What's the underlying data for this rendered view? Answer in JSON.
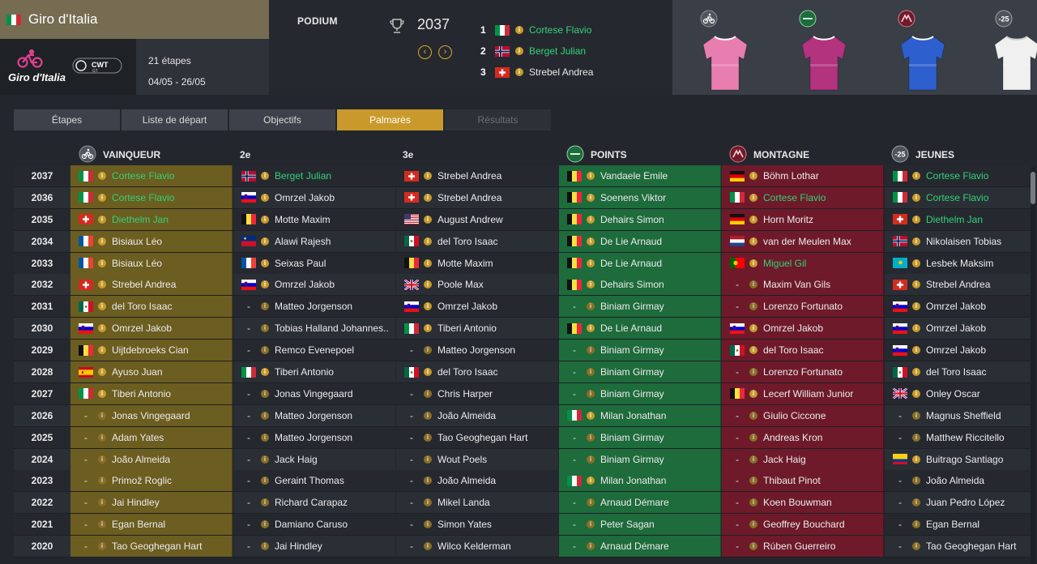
{
  "race": {
    "title": "Giro d'Italia",
    "flag": "it",
    "logo_text": "Giro d'Italia",
    "badge_text": "CWT",
    "badge_sub": "GT",
    "stages": "21 étapes",
    "dates": "04/05 - 26/05"
  },
  "podium": {
    "label": "PODIUM",
    "year": "2037",
    "prev_icon": "chevron-left-icon",
    "next_icon": "chevron-right-icon",
    "entries": [
      {
        "pos": "1",
        "flag": "it",
        "name": "Cortese Flavio",
        "highlight": true
      },
      {
        "pos": "2",
        "flag": "no",
        "name": "Berget Julian",
        "highlight": true
      },
      {
        "pos": "3",
        "flag": "ch",
        "name": "Strebel Andrea",
        "highlight": false
      }
    ]
  },
  "jerseys": [
    {
      "name": "leader-jersey",
      "icon": "cyclist-icon",
      "color": "#e87eb0"
    },
    {
      "name": "points-jersey",
      "icon": "points-icon",
      "color": "#b3337e"
    },
    {
      "name": "mountain-jersey",
      "icon": "mountain-icon",
      "color": "#2d5fcf"
    },
    {
      "name": "youth-jersey",
      "icon": "youth-icon",
      "color": "#f0f0f0"
    }
  ],
  "tabs": [
    {
      "label": "Étapes",
      "state": "normal"
    },
    {
      "label": "Liste de départ",
      "state": "normal"
    },
    {
      "label": "Objectifs",
      "state": "normal"
    },
    {
      "label": "Palmarès",
      "state": "active"
    },
    {
      "label": "Résultats",
      "state": "disabled"
    }
  ],
  "columns": {
    "winner": "VAINQUEUR",
    "second": "2e",
    "third": "3e",
    "points": "POINTS",
    "mountain": "MONTAGNE",
    "youth": "JEUNES",
    "youth_badge": "-25"
  },
  "colors": {
    "winner_bg": "#6c5d20",
    "points_bg": "#1e6b3c",
    "mountain_bg": "#6e1a2a",
    "active_tab": "#c99a2b",
    "highlight_name": "#33d17a"
  },
  "rows": [
    {
      "year": "2037",
      "win": {
        "flag": "it",
        "name": "Cortese Flavio",
        "hl": true
      },
      "second": {
        "flag": "no",
        "name": "Berget Julian",
        "hl": true
      },
      "third": {
        "flag": "ch",
        "name": "Strebel Andrea"
      },
      "points": {
        "flag": "be",
        "name": "Vandaele Emile"
      },
      "mountain": {
        "flag": "de",
        "name": "Böhm Lothar"
      },
      "youth": {
        "flag": "it",
        "name": "Cortese Flavio",
        "hl": true
      }
    },
    {
      "year": "2036",
      "win": {
        "flag": "it",
        "name": "Cortese Flavio",
        "hl": true
      },
      "second": {
        "flag": "si",
        "name": "Omrzel Jakob"
      },
      "third": {
        "flag": "ch",
        "name": "Strebel Andrea"
      },
      "points": {
        "flag": "be",
        "name": "Soenens Viktor"
      },
      "mountain": {
        "flag": "it",
        "name": "Cortese Flavio",
        "hl": true
      },
      "youth": {
        "flag": "it",
        "name": "Cortese Flavio",
        "hl": true
      }
    },
    {
      "year": "2035",
      "win": {
        "flag": "ch",
        "name": "Diethelm Jan",
        "hl": true
      },
      "second": {
        "flag": "be",
        "name": "Motte Maxim"
      },
      "third": {
        "flag": "us",
        "name": "August Andrew"
      },
      "points": {
        "flag": "be",
        "name": "Dehairs Simon"
      },
      "mountain": {
        "flag": "de",
        "name": "Horn Moritz"
      },
      "youth": {
        "flag": "ch",
        "name": "Diethelm Jan",
        "hl": true
      }
    },
    {
      "year": "2034",
      "win": {
        "flag": "fr",
        "name": "Bisiaux Léo"
      },
      "second": {
        "flag": "li",
        "name": "Alawi Rajesh"
      },
      "third": {
        "flag": "mx",
        "name": "del Toro Isaac"
      },
      "points": {
        "flag": "be",
        "name": "De Lie Arnaud"
      },
      "mountain": {
        "flag": "nl",
        "name": "van der Meulen Max"
      },
      "youth": {
        "flag": "no",
        "name": "Nikolaisen Tobias"
      }
    },
    {
      "year": "2033",
      "win": {
        "flag": "fr",
        "name": "Bisiaux Léo"
      },
      "second": {
        "flag": "fr",
        "name": "Seixas Paul"
      },
      "third": {
        "flag": "be",
        "name": "Motte Maxim"
      },
      "points": {
        "flag": "be",
        "name": "De Lie Arnaud"
      },
      "mountain": {
        "flag": "pt",
        "name": "Miguel Gil",
        "hl": true
      },
      "youth": {
        "flag": "kz",
        "name": "Lesbek Maksim"
      }
    },
    {
      "year": "2032",
      "win": {
        "flag": "ch",
        "name": "Strebel Andrea"
      },
      "second": {
        "flag": "si",
        "name": "Omrzel Jakob"
      },
      "third": {
        "flag": "gb",
        "name": "Poole Max"
      },
      "points": {
        "flag": "be",
        "name": "Dehairs Simon"
      },
      "mountain": {
        "flag": "-",
        "name": "Maxim Van Gils"
      },
      "youth": {
        "flag": "ch",
        "name": "Strebel Andrea"
      }
    },
    {
      "year": "2031",
      "win": {
        "flag": "mx",
        "name": "del Toro Isaac"
      },
      "second": {
        "flag": "-",
        "name": "Matteo Jorgenson"
      },
      "third": {
        "flag": "si",
        "name": "Omrzel Jakob"
      },
      "points": {
        "flag": "-",
        "name": "Biniam Girmay"
      },
      "mountain": {
        "flag": "-",
        "name": "Lorenzo Fortunato"
      },
      "youth": {
        "flag": "si",
        "name": "Omrzel Jakob"
      }
    },
    {
      "year": "2030",
      "win": {
        "flag": "si",
        "name": "Omrzel Jakob"
      },
      "second": {
        "flag": "-",
        "name": "Tobias Halland Johannes.."
      },
      "third": {
        "flag": "it",
        "name": "Tiberi Antonio"
      },
      "points": {
        "flag": "be",
        "name": "De Lie Arnaud"
      },
      "mountain": {
        "flag": "si",
        "name": "Omrzel Jakob"
      },
      "youth": {
        "flag": "si",
        "name": "Omrzel Jakob"
      }
    },
    {
      "year": "2029",
      "win": {
        "flag": "be",
        "name": "Uijtdebroeks Cian"
      },
      "second": {
        "flag": "-",
        "name": "Remco Evenepoel"
      },
      "third": {
        "flag": "-",
        "name": "Matteo Jorgenson"
      },
      "points": {
        "flag": "-",
        "name": "Biniam Girmay"
      },
      "mountain": {
        "flag": "mx",
        "name": "del Toro Isaac"
      },
      "youth": {
        "flag": "si",
        "name": "Omrzel Jakob"
      }
    },
    {
      "year": "2028",
      "win": {
        "flag": "es",
        "name": "Ayuso Juan"
      },
      "second": {
        "flag": "it",
        "name": "Tiberi Antonio"
      },
      "third": {
        "flag": "mx",
        "name": "del Toro Isaac"
      },
      "points": {
        "flag": "-",
        "name": "Biniam Girmay"
      },
      "mountain": {
        "flag": "-",
        "name": "Lorenzo Fortunato"
      },
      "youth": {
        "flag": "mx",
        "name": "del Toro Isaac"
      }
    },
    {
      "year": "2027",
      "win": {
        "flag": "it",
        "name": "Tiberi Antonio"
      },
      "second": {
        "flag": "-",
        "name": "Jonas Vingegaard"
      },
      "third": {
        "flag": "-",
        "name": "Chris Harper"
      },
      "points": {
        "flag": "-",
        "name": "Biniam Girmay"
      },
      "mountain": {
        "flag": "be",
        "name": "Lecerf William Junior"
      },
      "youth": {
        "flag": "gb",
        "name": "Onley Oscar"
      }
    },
    {
      "year": "2026",
      "win": {
        "flag": "-",
        "name": "Jonas Vingegaard"
      },
      "second": {
        "flag": "-",
        "name": "Matteo Jorgenson"
      },
      "third": {
        "flag": "-",
        "name": "João Almeida"
      },
      "points": {
        "flag": "it",
        "name": "Milan Jonathan"
      },
      "mountain": {
        "flag": "-",
        "name": "Giulio Ciccone"
      },
      "youth": {
        "flag": "-",
        "name": "Magnus Sheffield"
      }
    },
    {
      "year": "2025",
      "win": {
        "flag": "-",
        "name": "Adam Yates"
      },
      "second": {
        "flag": "-",
        "name": "Matteo Jorgenson"
      },
      "third": {
        "flag": "-",
        "name": "Tao Geoghegan Hart"
      },
      "points": {
        "flag": "-",
        "name": "Biniam Girmay"
      },
      "mountain": {
        "flag": "-",
        "name": "Andreas Kron"
      },
      "youth": {
        "flag": "-",
        "name": "Matthew Riccitello"
      }
    },
    {
      "year": "2024",
      "win": {
        "flag": "-",
        "name": "João Almeida"
      },
      "second": {
        "flag": "-",
        "name": "Jack Haig"
      },
      "third": {
        "flag": "-",
        "name": "Wout Poels"
      },
      "points": {
        "flag": "-",
        "name": "Biniam Girmay"
      },
      "mountain": {
        "flag": "-",
        "name": "Jack Haig"
      },
      "youth": {
        "flag": "co",
        "name": "Buitrago Santiago"
      }
    },
    {
      "year": "2023",
      "win": {
        "flag": "-",
        "name": "Primož Roglic"
      },
      "second": {
        "flag": "-",
        "name": "Geraint Thomas"
      },
      "third": {
        "flag": "-",
        "name": "João Almeida"
      },
      "points": {
        "flag": "it",
        "name": "Milan Jonathan"
      },
      "mountain": {
        "flag": "-",
        "name": "Thibaut Pinot"
      },
      "youth": {
        "flag": "-",
        "name": "João Almeida"
      }
    },
    {
      "year": "2022",
      "win": {
        "flag": "-",
        "name": "Jai Hindley"
      },
      "second": {
        "flag": "-",
        "name": "Richard Carapaz"
      },
      "third": {
        "flag": "-",
        "name": "Mikel Landa"
      },
      "points": {
        "flag": "-",
        "name": "Arnaud Démare"
      },
      "mountain": {
        "flag": "-",
        "name": "Koen Bouwman"
      },
      "youth": {
        "flag": "-",
        "name": "Juan Pedro López"
      }
    },
    {
      "year": "2021",
      "win": {
        "flag": "-",
        "name": "Egan Bernal"
      },
      "second": {
        "flag": "-",
        "name": "Damiano Caruso"
      },
      "third": {
        "flag": "-",
        "name": "Simon Yates"
      },
      "points": {
        "flag": "-",
        "name": "Peter Sagan"
      },
      "mountain": {
        "flag": "-",
        "name": "Geoffrey Bouchard"
      },
      "youth": {
        "flag": "-",
        "name": "Egan Bernal"
      }
    },
    {
      "year": "2020",
      "win": {
        "flag": "-",
        "name": "Tao Geoghegan Hart"
      },
      "second": {
        "flag": "-",
        "name": "Jai Hindley"
      },
      "third": {
        "flag": "-",
        "name": "Wilco Kelderman"
      },
      "points": {
        "flag": "-",
        "name": "Arnaud Démare"
      },
      "mountain": {
        "flag": "-",
        "name": "Rúben Guerreiro"
      },
      "youth": {
        "flag": "-",
        "name": "Tao Geoghegan Hart"
      }
    }
  ]
}
